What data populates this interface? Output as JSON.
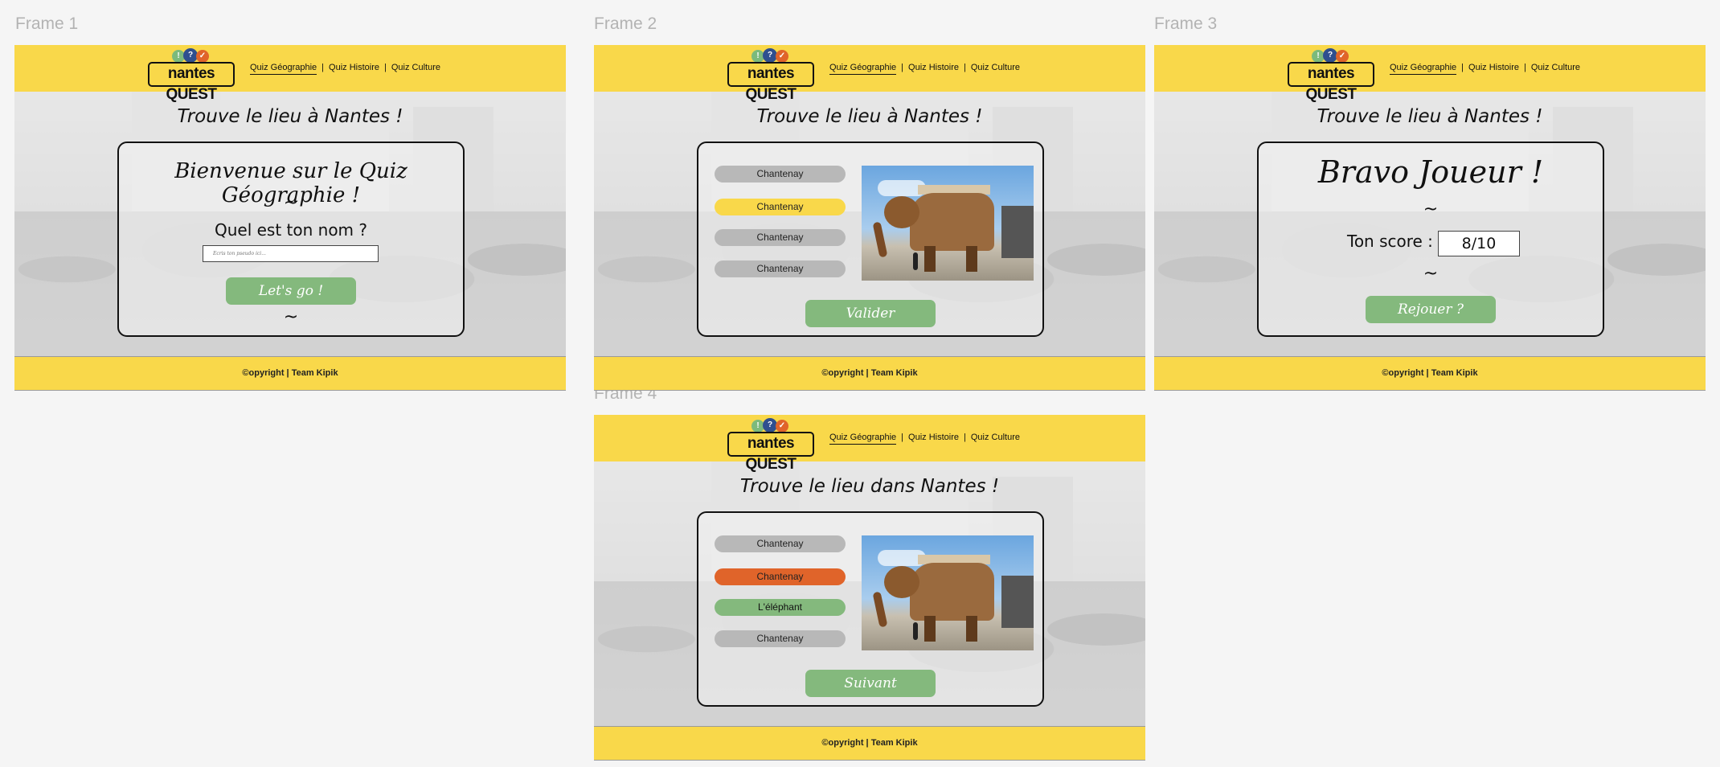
{
  "frames": [
    {
      "label": "Frame 1"
    },
    {
      "label": "Frame 2"
    },
    {
      "label": "Frame 3"
    },
    {
      "label": "Frame 4"
    }
  ],
  "header": {
    "logo_text": "nantes QUEST",
    "bubble_1": "!",
    "bubble_2": "?",
    "bubble_3": "✓",
    "nav": [
      "Quiz Géographie",
      "Quiz Histoire",
      "Quiz Culture"
    ],
    "separator": "|"
  },
  "titles": {
    "lieu_a": "Trouve le lieu à Nantes !",
    "lieu_dans": "Trouve le lieu dans Nantes !"
  },
  "footer": "©opyright | Team Kipik",
  "tilde": "~",
  "welcome": {
    "heading": "Bienvenue sur le Quiz Géographie !",
    "question": "Quel est ton nom ?",
    "input_placeholder": "Écris ton pseudo ici...",
    "button": "Let's go !"
  },
  "quiz": {
    "options": [
      "Chantenay",
      "Chantenay",
      "Chantenay",
      "Chantenay"
    ],
    "button": "Valider"
  },
  "result": {
    "heading": "Bravo Joueur !",
    "score_label": "Ton score :",
    "score_value": "8/10",
    "button": "Rejouer ?"
  },
  "correction": {
    "options": [
      "Chantenay",
      "Chantenay",
      "L'éléphant",
      "Chantenay"
    ],
    "button": "Suivant"
  },
  "colors": {
    "yellow": "#f9d84a",
    "green": "#84b97d",
    "orange": "#e0642a",
    "grey_option": "#b8b8b8"
  }
}
